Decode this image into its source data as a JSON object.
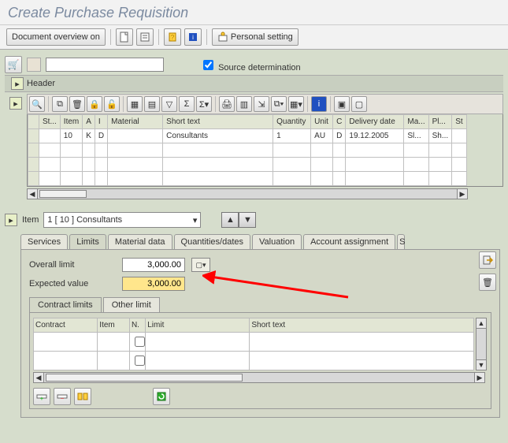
{
  "title": "Create Purchase Requisition",
  "toolbar": {
    "doc_overview": "Document overview on",
    "personal_setting": "Personal setting"
  },
  "cart_row": {
    "cart_value": "",
    "source_determination": "Source determination",
    "source_checked": true
  },
  "header_label": "Header",
  "grid": {
    "columns": [
      "St...",
      "Item",
      "A",
      "I",
      "Material",
      "Short text",
      "Quantity",
      "Unit",
      "C",
      "Delivery date",
      "Ma...",
      "Pl...",
      "St"
    ],
    "rows": [
      {
        "st": "",
        "item": "10",
        "a": "K",
        "i": "D",
        "material": "",
        "short_text": "Consultants",
        "quantity": "1",
        "unit": "AU",
        "c": "D",
        "delivery_date": "19.12.2005",
        "ma": "Sl...",
        "pl": "Sh...",
        "st2": ""
      }
    ]
  },
  "item_section": {
    "label": "Item",
    "selected": "1 [ 10 ] Consultants"
  },
  "tabs": [
    "Services",
    "Limits",
    "Material data",
    "Quantities/dates",
    "Valuation",
    "Account assignment"
  ],
  "active_tab": 1,
  "limits_form": {
    "overall_limit_label": "Overall limit",
    "overall_limit_value": "3,000.00",
    "expected_value_label": "Expected value",
    "expected_value_value": "3,000.00"
  },
  "subtabs": [
    "Contract limits",
    "Other limit"
  ],
  "active_subtab": 0,
  "subtable": {
    "columns": [
      "Contract",
      "Item",
      "N.",
      "Limit",
      "Short text"
    ],
    "empty_rows": 2
  }
}
